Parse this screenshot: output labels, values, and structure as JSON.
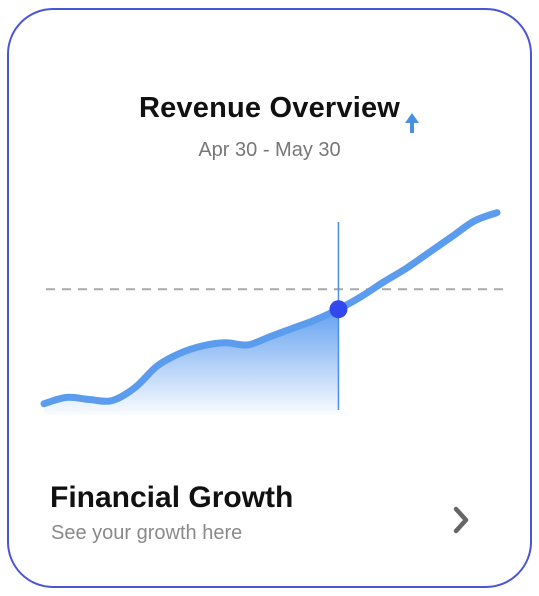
{
  "card": {
    "title": "Revenue Overview",
    "date_range": "Apr 30 - May 30",
    "trend_icon": "arrow-up-icon",
    "footer": {
      "title": "Financial Growth",
      "subtitle": "See your growth here",
      "action_icon": "chevron-right-icon"
    }
  },
  "colors": {
    "border": "#4a55d6",
    "line": "#5b9cef",
    "marker": "#3347ee",
    "reference_line": "#aaaaaa"
  },
  "chart_data": {
    "type": "line",
    "title": "",
    "xlabel": "",
    "ylabel": "",
    "grid": false,
    "legend": "none",
    "ylim": [
      0,
      100
    ],
    "x": [
      0,
      5,
      10,
      15,
      20,
      25,
      30,
      35,
      40,
      45,
      50,
      55,
      60,
      65,
      70,
      75,
      80,
      85,
      90,
      95,
      100
    ],
    "series": [
      {
        "values": [
          6,
          12,
          10,
          9,
          21,
          42,
          54,
          61,
          64,
          62,
          70,
          78,
          86,
          96,
          108,
          122,
          135,
          150,
          165,
          180,
          188
        ]
      }
    ],
    "highlight": {
      "x": 65,
      "y": 96
    },
    "reference_y": 115
  }
}
